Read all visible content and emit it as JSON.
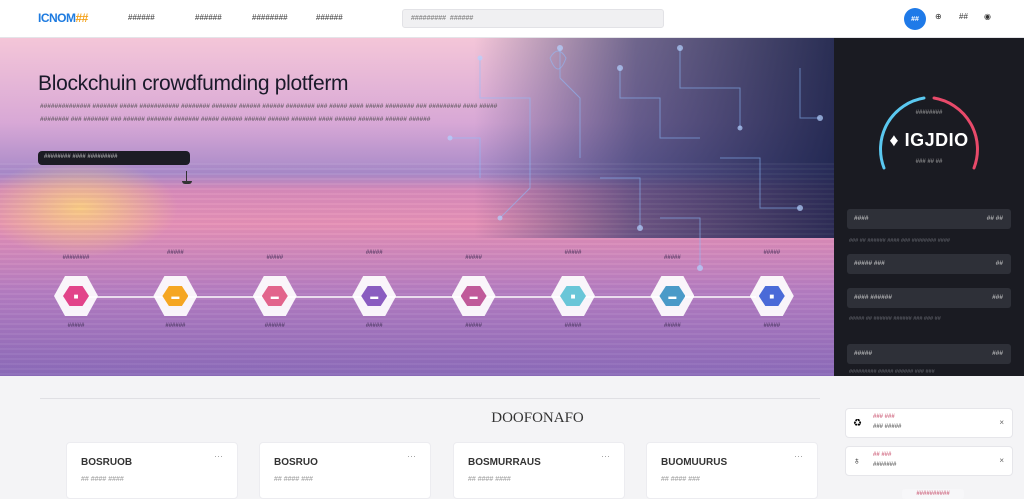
{
  "nav": {
    "logo_main": "ICNOM",
    "logo_accent": "##",
    "links": [
      "######",
      "######",
      "########",
      "######"
    ],
    "search_placeholder": "#########  ######",
    "avatar": "##",
    "icons": [
      "bell-icon",
      "grid-icon",
      "settings-icon"
    ],
    "icon_glyphs": [
      "⊕",
      "##",
      "◉"
    ]
  },
  "hero": {
    "title": "Blockchuin crowdfumding plotferm",
    "description": "############## ####### ##### ########### ######## ####### ###### ###### ######## ### ##### #### ##### ######## ### ######### #### ##### ######## ### ####### ### ###### ####### ####### ##### ###### ###### ###### ####### #### ###### ####### ###### ######",
    "cta": "######## #### #########",
    "steps": [
      {
        "top": "########",
        "bottom": "#####",
        "color": "#e2448a",
        "icon": "■"
      },
      {
        "top": "#####",
        "bottom": "######",
        "color": "#f5a623",
        "icon": "▬"
      },
      {
        "top": "#####",
        "bottom": "######",
        "color": "#e2648c",
        "icon": "▬"
      },
      {
        "top": "#####",
        "bottom": "#####",
        "color": "#8a5cc0",
        "icon": "▬"
      },
      {
        "top": "#####",
        "bottom": "#####",
        "color": "#c05a9a",
        "icon": "▬"
      },
      {
        "top": "#####",
        "bottom": "#####",
        "color": "#6ac6d8",
        "icon": "■"
      },
      {
        "top": "#####",
        "bottom": "#####",
        "color": "#4a9ac8",
        "icon": "▬"
      },
      {
        "top": "#####",
        "bottom": "#####",
        "color": "#4a6ad8",
        "icon": "■"
      }
    ]
  },
  "side": {
    "gauge_top": "########",
    "gauge_value": "♦ IGJDIO",
    "gauge_sub": "### ## ##",
    "rows": [
      {
        "label": "####",
        "value": "## ##"
      },
      {
        "label": "##### ###",
        "value": "##"
      },
      {
        "label": "#### ######",
        "value": "###"
      },
      {
        "label": "#####",
        "value": "###"
      }
    ],
    "notes": [
      "### ## ###### #### ### ######## ####",
      "##### ## ###### ###### ### ### ##",
      "######### ##### ###### ### ###"
    ]
  },
  "section": {
    "title": "DOOFONAFO",
    "cards": [
      {
        "title": "BOSRUOB",
        "sub": "## #### ####"
      },
      {
        "title": "BOSRUO",
        "sub": "## #### ###"
      },
      {
        "title": "BOSMURRAUS",
        "sub": "## #### ####"
      },
      {
        "title": "BUOMUURUS",
        "sub": "## #### ###"
      }
    ],
    "card_menu": "···"
  },
  "mini": [
    {
      "icon": "♻",
      "title": "### ###",
      "sub": "### #####",
      "close": "×"
    },
    {
      "icon": "♁",
      "title": "## ###",
      "sub": "#######",
      "close": "×"
    }
  ],
  "pill": "##########"
}
